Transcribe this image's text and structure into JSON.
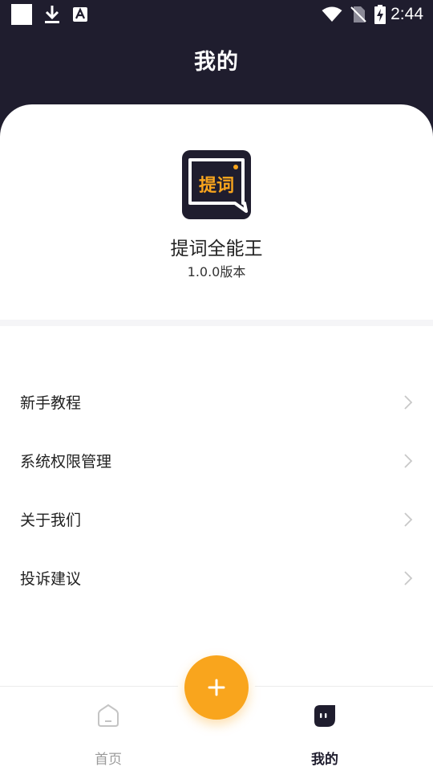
{
  "status_bar": {
    "time": "2:44",
    "icons": [
      "square-notification-icon",
      "download-icon",
      "text-a-icon",
      "wifi-icon",
      "no-sim-icon",
      "battery-charging-icon"
    ]
  },
  "header": {
    "title": "我的"
  },
  "app": {
    "logo_text": "提词",
    "name": "提词全能王",
    "version": "1.0.0版本"
  },
  "menu": {
    "items": [
      {
        "label": "新手教程"
      },
      {
        "label": "系统权限管理"
      },
      {
        "label": "关于我们"
      },
      {
        "label": "投诉建议"
      }
    ]
  },
  "bottom_nav": {
    "items": [
      {
        "label": "首页",
        "icon": "home-icon",
        "active": false
      },
      {
        "label": "我的",
        "icon": "profile-face-icon",
        "active": true
      }
    ],
    "fab_icon": "plus-icon"
  },
  "colors": {
    "dark": "#1f1d2e",
    "accent": "#f9a51d",
    "text": "#222222",
    "inactive": "#9b9b9b"
  }
}
